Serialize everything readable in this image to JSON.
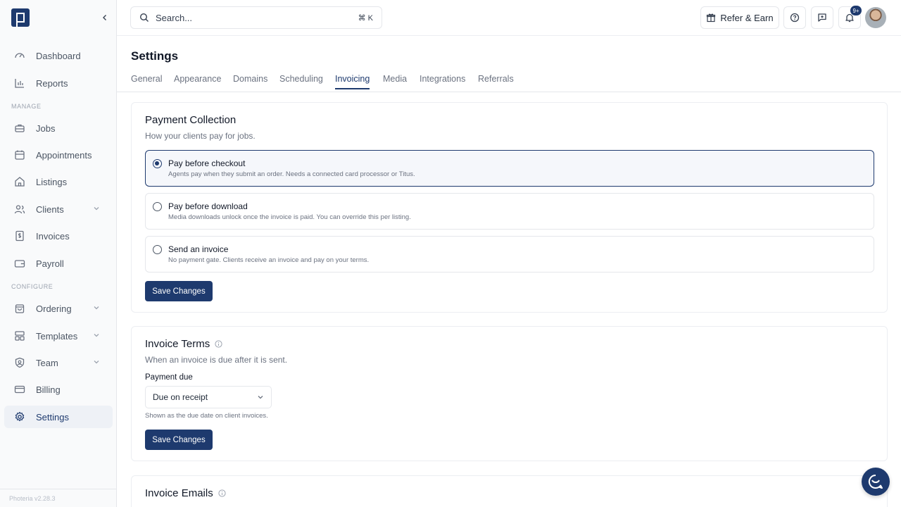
{
  "sidebar": {
    "logo_icon": "brand-logo",
    "collapse_icon": "chevron-left-icon",
    "items": [
      {
        "label": "Dashboard",
        "icon": "gauge-icon"
      },
      {
        "label": "Reports",
        "icon": "bar-chart-icon"
      },
      {
        "label": "Jobs",
        "icon": "briefcase-icon"
      },
      {
        "label": "Appointments",
        "icon": "calendar-icon"
      },
      {
        "label": "Listings",
        "icon": "home-icon"
      },
      {
        "label": "Clients",
        "icon": "users-icon",
        "expandable": true
      },
      {
        "label": "Invoices",
        "icon": "invoice-icon"
      },
      {
        "label": "Payroll",
        "icon": "wallet-icon"
      },
      {
        "label": "Ordering",
        "icon": "shopping-bag-icon",
        "expandable": true
      },
      {
        "label": "Templates",
        "icon": "layout-icon",
        "expandable": true
      },
      {
        "label": "Team",
        "icon": "shield-icon",
        "expandable": true
      },
      {
        "label": "Billing",
        "icon": "credit-card-icon"
      },
      {
        "label": "Settings",
        "icon": "gear-icon",
        "active": true
      }
    ],
    "sections": {
      "manage": "MANAGE",
      "configure": "CONFIGURE"
    },
    "version": "Photeria v2.28.3"
  },
  "topbar": {
    "search_placeholder": "Search...",
    "search_shortcut": "⌘ K",
    "refer_label": "Refer & Earn",
    "notifications_badge": "9+"
  },
  "main": {
    "title": "Settings",
    "tabs": [
      {
        "label": "General"
      },
      {
        "label": "Appearance"
      },
      {
        "label": "Domains"
      },
      {
        "label": "Scheduling"
      },
      {
        "label": "Invoicing",
        "active": true
      },
      {
        "label": "Media"
      },
      {
        "label": "Integrations"
      },
      {
        "label": "Referrals"
      }
    ],
    "payment_collection": {
      "title": "Payment Collection",
      "subtitle": "How your clients pay for jobs.",
      "options": [
        {
          "title": "Pay before checkout",
          "desc": "Agents pay when they submit an order. Needs a connected card processor or Titus.",
          "selected": true
        },
        {
          "title": "Pay before download",
          "desc": "Media downloads unlock once the invoice is paid. You can override this per listing.",
          "selected": false
        },
        {
          "title": "Send an invoice",
          "desc": "No payment gate. Clients receive an invoice and pay on your terms.",
          "selected": false
        }
      ],
      "save_label": "Save Changes"
    },
    "invoice_terms": {
      "title": "Invoice Terms",
      "subtitle": "When an invoice is due after it is sent.",
      "field_label": "Payment due",
      "field_value": "Due on receipt",
      "help": "Shown as the due date on client invoices.",
      "save_label": "Save Changes"
    },
    "invoice_emails": {
      "title": "Invoice Emails"
    }
  },
  "colors": {
    "accent": "#1e3a6e",
    "sidebar_bg": "#f9fafb",
    "border": "#e5e7eb"
  }
}
